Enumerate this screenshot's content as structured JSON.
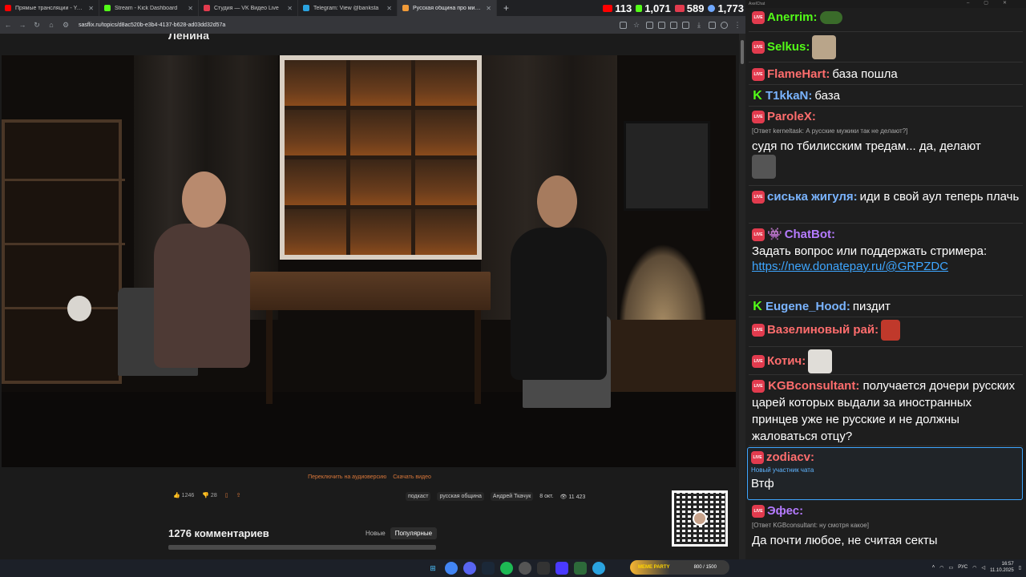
{
  "browser": {
    "tabs": [
      {
        "label": "Прямые трансляции - YouTube",
        "color": "#ff0000"
      },
      {
        "label": "Stream - Kick Dashboard",
        "color": "#53fc18"
      },
      {
        "label": "Студия — VK Видео Live",
        "color": "#e23b4e"
      },
      {
        "label": "Telegram: View @banksta",
        "color": "#2aa3e0"
      },
      {
        "label": "Русская община про мигр...",
        "color": "#f29b38"
      }
    ],
    "new_tab": "+",
    "url": "sasflix.ru/topics/d8ac520b-e3b4-4137-b628-ad03dd32d57a",
    "stats": [
      {
        "value": "113",
        "color": "#ff0000"
      },
      {
        "value": "1,071",
        "color": "#53fc18"
      },
      {
        "value": "589",
        "color": "#e23b4e"
      },
      {
        "value": "1,773",
        "color": "#6fa8ff"
      }
    ]
  },
  "page": {
    "title_fragment": "Ленина",
    "audio_link": "Переключить на аудиоверсию",
    "download_link": "Скачать видео",
    "likes": "1246",
    "dislikes": "28",
    "tags": [
      "подкаст",
      "русская община",
      "Андрей Ткачук"
    ],
    "date": "8 окт.",
    "views": "11 423",
    "comments_title": "1276 комментариев",
    "sort": [
      "Новые",
      "Популярные"
    ]
  },
  "chat": {
    "window_title": "AxelChat",
    "messages": [
      {
        "platform": "vk",
        "name": "Anerrim:",
        "color": "#53fc18",
        "text": "",
        "emote": "#3a6b2a"
      },
      {
        "platform": "vk",
        "name": "Selkus:",
        "color": "#53fc18",
        "text": "",
        "emote": "#b9a58a"
      },
      {
        "platform": "vk",
        "name": "FlameHart:",
        "color": "#ff6d6d",
        "text": "база пошла"
      },
      {
        "platform": "kick",
        "name": "T1kkaN:",
        "color": "#7ab4ff",
        "text": "база"
      },
      {
        "platform": "vk",
        "name": "ParoleX:",
        "color": "#ff6d6d",
        "reply": "[Ответ kerneltask: А русские мужики так не делают?]",
        "text": "судя по тбилисским тредам... да, делают",
        "emote": "#555555"
      },
      {
        "platform": "vk",
        "name": "сиська жигуля:",
        "color": "#7ab4ff",
        "text": "иди в свой аул теперь плачь"
      },
      {
        "platform": "vk",
        "name": "ChatBot:",
        "color": "#b57bff",
        "text": "Задать вопрос или поддержать стримера:",
        "link": "https://new.donatepay.ru/@GRPZDC"
      },
      {
        "platform": "kick",
        "name": "Eugene_Hood:",
        "color": "#7ab4ff",
        "text": "пиздит"
      },
      {
        "platform": "vk",
        "name": "Вазелиновый рай:",
        "color": "#ff6d6d",
        "text": "",
        "emote": "#c0392b"
      },
      {
        "platform": "vk",
        "name": "Котич:",
        "color": "#ff6d6d",
        "text": "",
        "emote": "#e0ddd8"
      },
      {
        "platform": "vk",
        "name": "KGBconsultant:",
        "color": "#ff6d6d",
        "text": "получается дочери русских царей которых выдали за иностранных принцев уже не русские и не должны жаловаться отцу?"
      },
      {
        "platform": "vk",
        "name": "zodiacv:",
        "color": "#ff6d6d",
        "badge": "Новый участник чата",
        "text": "Втф"
      },
      {
        "platform": "vk",
        "name": "Эфес:",
        "color": "#b57bff",
        "reply": "[Ответ KGBconsultant: ну смотря какое]",
        "text": "Да почти любое, не считая секты"
      }
    ]
  },
  "taskbar": {
    "meme_title": "MEME PARTY",
    "meme_score": "800 / 1500",
    "lang": "РУС",
    "time": "16:57",
    "date": "11.10.2025"
  }
}
